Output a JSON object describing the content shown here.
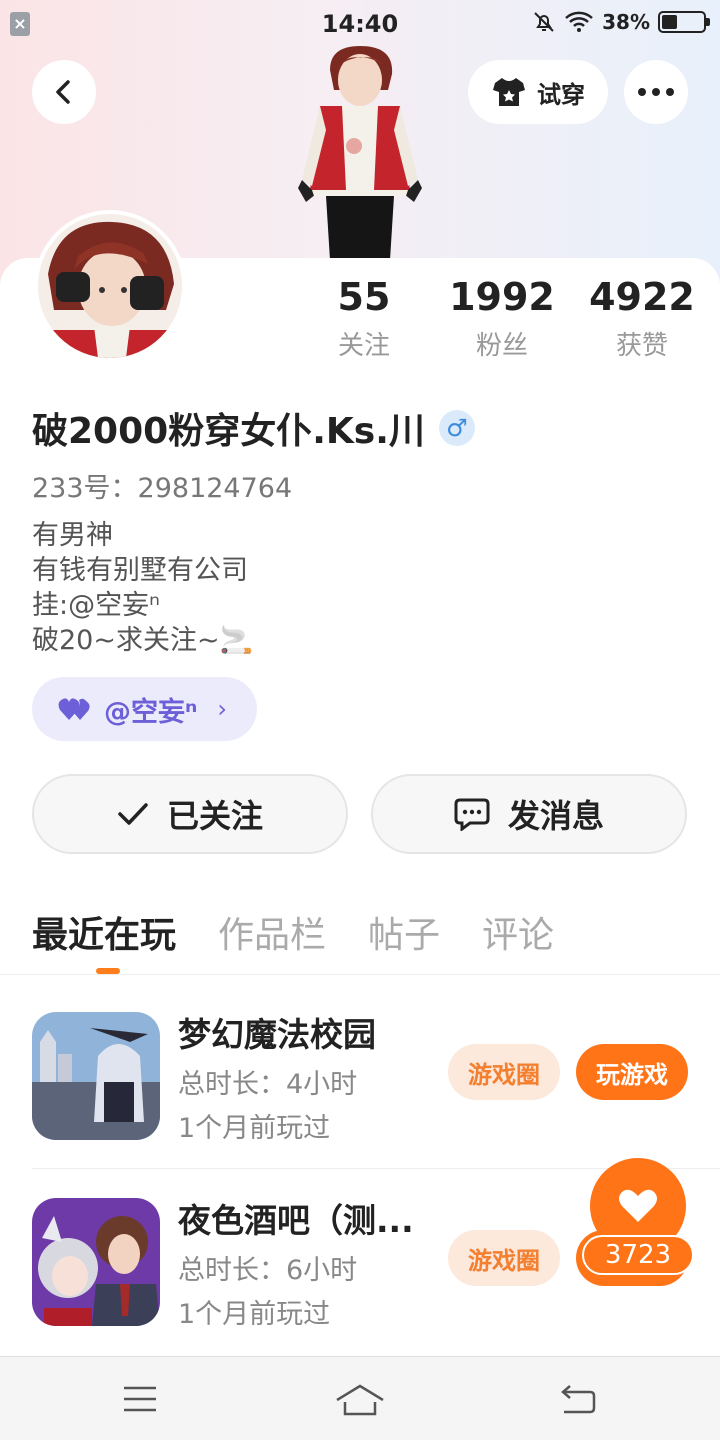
{
  "status_bar": {
    "time": "14:40",
    "battery": "38%",
    "battery_level": 0.38
  },
  "header": {
    "try_on_label": "试穿"
  },
  "profile": {
    "stats": [
      {
        "value": "55",
        "label": "关注"
      },
      {
        "value": "1992",
        "label": "粉丝"
      },
      {
        "value": "4922",
        "label": "获赞"
      }
    ],
    "name": "破2000粉穿女仆.Ks.川",
    "gender_symbol": "♂",
    "uid": "233号：298124764",
    "bio": [
      "有男神",
      "有钱有别墅有公司",
      "挂:@空妄ⁿ",
      "破20~求关注~🚬"
    ],
    "fan_pill_label": "@空妄ⁿ",
    "fan_pill_chevron": "›",
    "follow_label": "已关注",
    "message_label": "发消息"
  },
  "tabs": [
    {
      "label": "最近在玩",
      "active": true
    },
    {
      "label": "作品栏",
      "active": false
    },
    {
      "label": "帖子",
      "active": false
    },
    {
      "label": "评论",
      "active": false
    }
  ],
  "games": [
    {
      "title": "梦幻魔法校园",
      "duration": "总时长：4小时",
      "last_played": "1个月前玩过",
      "circle_label": "游戏圈",
      "play_label": "玩游戏"
    },
    {
      "title": "夜色酒吧（测...",
      "duration": "总时长：6小时",
      "last_played": "1个月前玩过",
      "circle_label": "游戏圈",
      "play_label": "玩游戏"
    }
  ],
  "like_fab": {
    "count": "3723"
  },
  "colors": {
    "accent": "#ff7417",
    "purple": "#6c5fd8",
    "gender_blue": "#3a8bdc"
  }
}
